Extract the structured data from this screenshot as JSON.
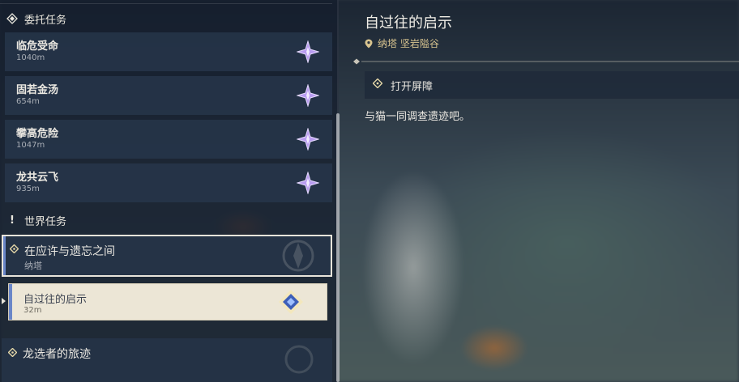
{
  "commissions": {
    "header": "委托任务",
    "items": [
      {
        "name": "临危受命",
        "distance": "1040m"
      },
      {
        "name": "固若金汤",
        "distance": "654m"
      },
      {
        "name": "攀高危险",
        "distance": "1047m"
      },
      {
        "name": "龙共云飞",
        "distance": "935m"
      }
    ]
  },
  "world_quests": {
    "header": "世界任务",
    "parent": {
      "title": "在应许与遗忘之间",
      "region": "纳塔"
    },
    "selected": {
      "title": "自过往的启示",
      "distance": "32m"
    },
    "collapsed": {
      "title": "龙选者的旅迹"
    }
  },
  "detail": {
    "title": "自过往的启示",
    "location": "纳塔 坚岩隘谷",
    "objective": "打开屏障",
    "description": "与猫一同调查遗迹吧。"
  },
  "colors": {
    "accent_gold": "#e5d7a8",
    "selection_blue": "#6a86c8",
    "commission_star": "#b89cf0"
  }
}
